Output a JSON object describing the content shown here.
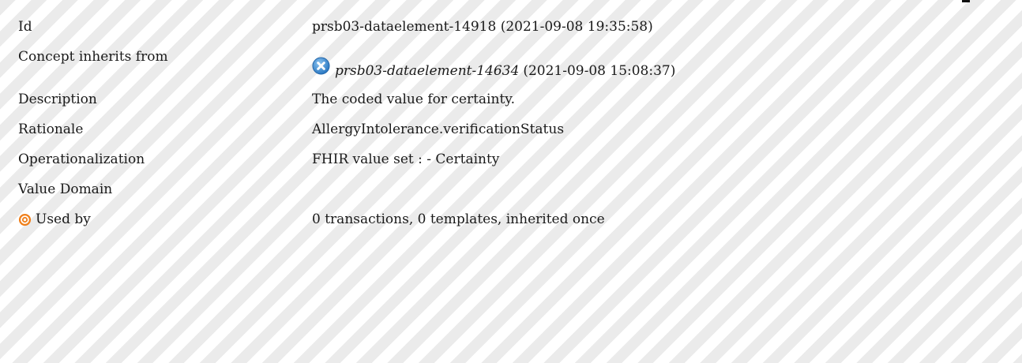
{
  "properties": {
    "id": {
      "label": "Id",
      "value": "prsb03-dataelement-14918 (2021-09-08 19:35:58)"
    },
    "inherits": {
      "label": "Concept inherits from",
      "ref_id": "prsb03-dataelement-14634",
      "ref_date": "(2021-09-08 15:08:37)",
      "icon": "blue-x-circle-icon"
    },
    "description": {
      "label": "Description",
      "value": "The coded value for certainty."
    },
    "rationale": {
      "label": "Rationale",
      "value": "AllergyIntolerance.verificationStatus"
    },
    "operationalization": {
      "label": "Operationalization",
      "value": "FHIR value set : - Certainty"
    },
    "value_domain": {
      "label": "Value Domain",
      "value": ""
    },
    "used_by": {
      "label": "Used by",
      "value": "0 transactions, 0 templates, inherited once",
      "icon": "target-icon"
    }
  },
  "colors": {
    "stripe": "#ebebeb",
    "text": "#1a1a1a",
    "ref_icon": "#3d8fd6",
    "target_icon": "#f07f1a"
  }
}
